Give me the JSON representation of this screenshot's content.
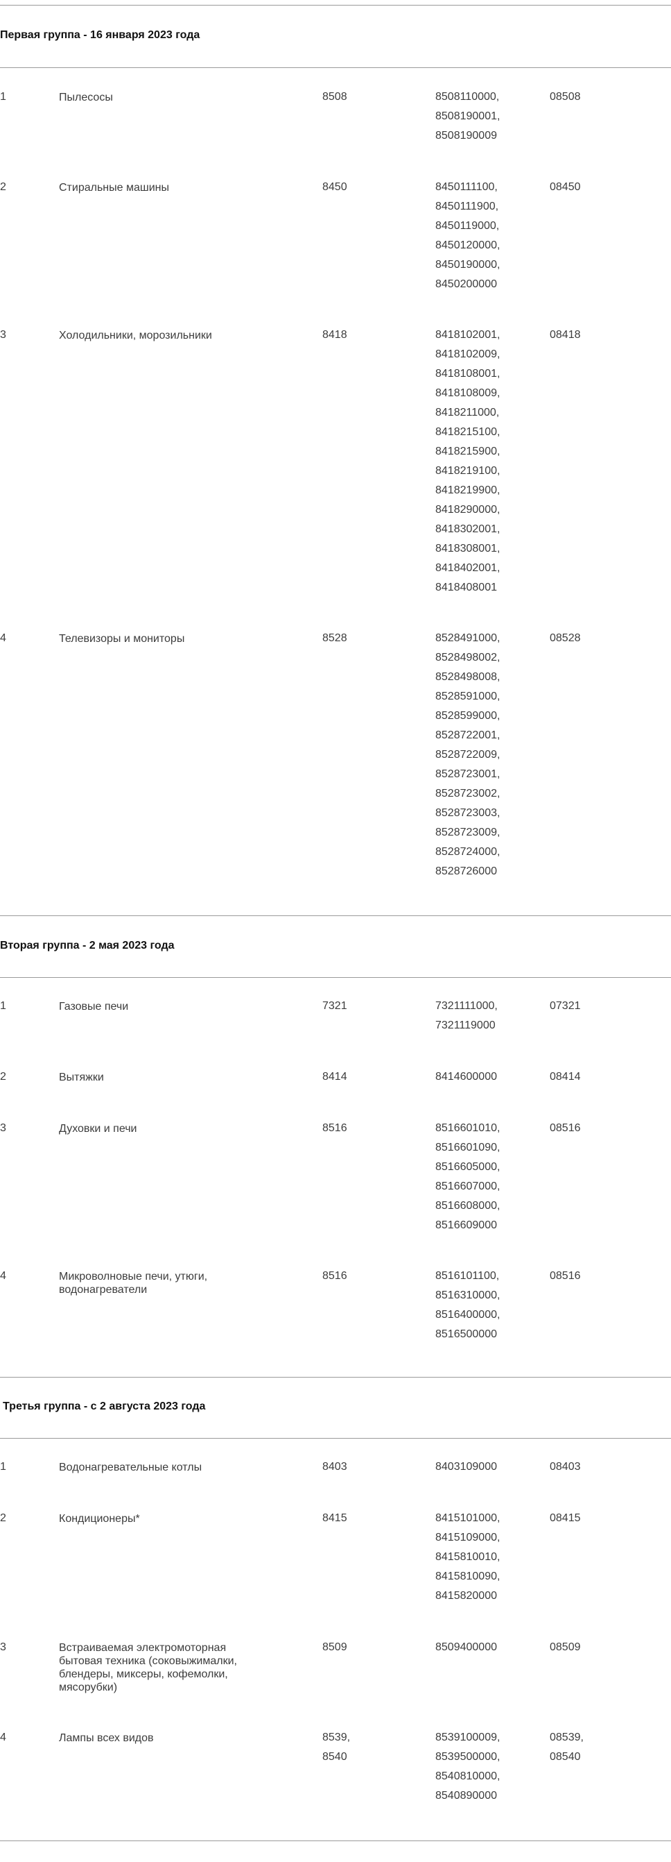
{
  "groups": [
    {
      "title": "Первая группа - 16 января 2023 года",
      "rows": [
        {
          "num": "1",
          "name": "Пылесосы",
          "hs": [
            "8508"
          ],
          "codes": [
            "8508110000,",
            "8508190001,",
            "8508190009"
          ],
          "code": [
            "08508"
          ]
        },
        {
          "num": "2",
          "name": "Стиральные машины",
          "hs": [
            "8450"
          ],
          "codes": [
            "8450111100,",
            "8450111900,",
            "8450119000,",
            "8450120000,",
            "8450190000,",
            "8450200000"
          ],
          "code": [
            "08450"
          ]
        },
        {
          "num": "3",
          "name": "Холодильники, морозильники",
          "hs": [
            "8418"
          ],
          "codes": [
            "8418102001,",
            "8418102009,",
            "8418108001,",
            "8418108009,",
            "8418211000,",
            "8418215100,",
            "8418215900,",
            "8418219100,",
            "8418219900,",
            "8418290000,",
            "8418302001,",
            "8418308001,",
            "8418402001,",
            "8418408001"
          ],
          "code": [
            "08418"
          ]
        },
        {
          "num": "4",
          "name": "Телевизоры и мониторы",
          "hs": [
            "8528"
          ],
          "codes": [
            "8528491000,",
            "8528498002,",
            "8528498008,",
            "8528591000,",
            "8528599000,",
            "8528722001,",
            "8528722009,",
            "8528723001,",
            "8528723002,",
            "8528723003,",
            "8528723009,",
            "8528724000,",
            "8528726000"
          ],
          "code": [
            "08528"
          ]
        }
      ]
    },
    {
      "title": "Вторая группа - 2 мая 2023 года",
      "rows": [
        {
          "num": "1",
          "name": "Газовые печи",
          "hs": [
            "7321"
          ],
          "codes": [
            "7321111000,",
            "7321119000"
          ],
          "code": [
            "07321"
          ]
        },
        {
          "num": "2",
          "name": "Вытяжки",
          "hs": [
            "8414"
          ],
          "codes": [
            "8414600000"
          ],
          "code": [
            "08414"
          ]
        },
        {
          "num": "3",
          "name": "Духовки и печи",
          "hs": [
            "8516"
          ],
          "codes": [
            "8516601010,",
            "8516601090,",
            "8516605000,",
            "8516607000,",
            "8516608000,",
            "8516609000"
          ],
          "code": [
            "08516"
          ]
        },
        {
          "num": "4",
          "name": "Микроволновые печи, утюги, водонагреватели",
          "hs": [
            "8516"
          ],
          "codes": [
            "8516101100,",
            "8516310000,",
            "8516400000,",
            "8516500000"
          ],
          "code": [
            "08516"
          ]
        }
      ]
    },
    {
      "title": "Третья группа - с 2 августа 2023 года",
      "rows": [
        {
          "num": "1",
          "name": "Водонагревательные котлы",
          "hs": [
            "8403"
          ],
          "codes": [
            "8403109000"
          ],
          "code": [
            "08403"
          ]
        },
        {
          "num": "2",
          "name": "Кондиционеры*",
          "hs": [
            "8415"
          ],
          "codes": [
            "8415101000,",
            "8415109000,",
            "8415810010,",
            "8415810090,",
            "8415820000"
          ],
          "code": [
            "08415"
          ]
        },
        {
          "num": "3",
          "name": "Встраиваемая электромоторная бытовая техника (соковыжималки, блендеры, миксеры, кофемолки, мясорубки)",
          "hs": [
            "8509"
          ],
          "codes": [
            "8509400000"
          ],
          "code": [
            "08509"
          ]
        },
        {
          "num": "4",
          "name": "Лампы всех видов",
          "hs": [
            "8539,",
            "8540"
          ],
          "codes": [
            "8539100009,",
            "8539500000,",
            "8540810000,",
            "8540890000"
          ],
          "code": [
            "08539,",
            "08540"
          ]
        }
      ]
    }
  ]
}
